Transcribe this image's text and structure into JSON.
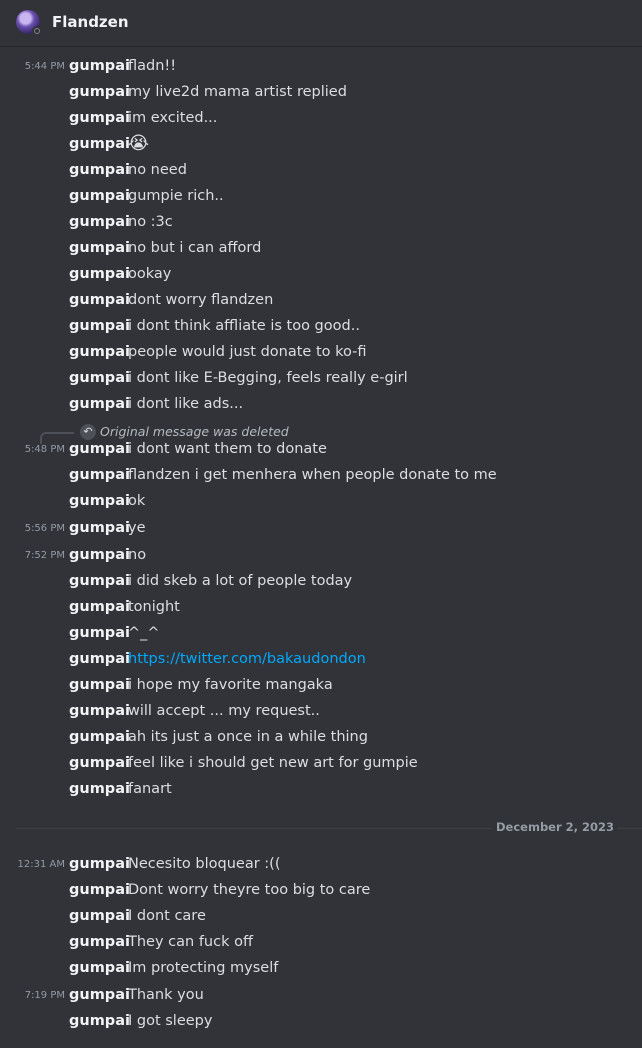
{
  "header": {
    "title": "Flandzen",
    "avatar_icon": "user-avatar-icon",
    "status_icon": "offline-status-icon"
  },
  "messages_before": [
    {
      "time": "5:44 PM",
      "author": "gumpai",
      "text": "fladn!!"
    },
    {
      "time": "",
      "author": "gumpai",
      "text": "my live2d mama artist replied"
    },
    {
      "time": "",
      "author": "gumpai",
      "text": "im excited..."
    },
    {
      "time": "",
      "author": "gumpai",
      "text": "😭"
    },
    {
      "time": "",
      "author": "gumpai",
      "text": "no need"
    },
    {
      "time": "",
      "author": "gumpai",
      "text": "gumpie rich.."
    },
    {
      "time": "",
      "author": "gumpai",
      "text": "no :3c"
    },
    {
      "time": "",
      "author": "gumpai",
      "text": "no but i can afford"
    },
    {
      "time": "",
      "author": "gumpai",
      "text": "ookay"
    },
    {
      "time": "",
      "author": "gumpai",
      "text": "dont worry flandzen"
    },
    {
      "time": "",
      "author": "gumpai",
      "text": "i dont think affliate is too good.."
    },
    {
      "time": "",
      "author": "gumpai",
      "text": "people would just donate to ko-fi"
    },
    {
      "time": "",
      "author": "gumpai",
      "text": "i dont like E-Begging, feels really e-girl"
    },
    {
      "time": "",
      "author": "gumpai",
      "text": "i dont like ads..."
    }
  ],
  "reply": {
    "icon": "reply-arrow-icon",
    "text": "Original message was deleted"
  },
  "messages_after": [
    {
      "time": "5:48 PM",
      "author": "gumpai",
      "text": "i dont want them to donate"
    },
    {
      "time": "",
      "author": "gumpai",
      "text": "flandzen i get menhera when people donate to me"
    },
    {
      "time": "",
      "author": "gumpai",
      "text": "ok"
    },
    {
      "time": "5:56 PM",
      "author": "gumpai",
      "text": "ye"
    },
    {
      "time": "7:52 PM",
      "author": "gumpai",
      "text": "no"
    },
    {
      "time": "",
      "author": "gumpai",
      "text": "i did skeb a lot of people today"
    },
    {
      "time": "",
      "author": "gumpai",
      "text": "tonight"
    },
    {
      "time": "",
      "author": "gumpai",
      "text": "^_^"
    },
    {
      "time": "",
      "author": "gumpai",
      "text": "https://twitter.com/bakaudondon",
      "link": true
    },
    {
      "time": "",
      "author": "gumpai",
      "text": "i hope my favorite mangaka"
    },
    {
      "time": "",
      "author": "gumpai",
      "text": "will accept ... my request.."
    },
    {
      "time": "",
      "author": "gumpai",
      "text": "ah its just a once in a while thing"
    },
    {
      "time": "",
      "author": "gumpai",
      "text": "feel like i should get new art for gumpie"
    },
    {
      "time": "",
      "author": "gumpai",
      "text": "fanart"
    }
  ],
  "date_divider": "December 2, 2023",
  "messages_dec2": [
    {
      "time": "12:31 AM",
      "author": "gumpai",
      "text": "Necesito bloquear :(("
    },
    {
      "time": "",
      "author": "gumpai",
      "text": "Dont worry theyre too big to care"
    },
    {
      "time": "",
      "author": "gumpai",
      "text": "I dont care"
    },
    {
      "time": "",
      "author": "gumpai",
      "text": "They can fuck off"
    },
    {
      "time": "",
      "author": "gumpai",
      "text": "Im protecting myself"
    },
    {
      "time": "7:19 PM",
      "author": "gumpai",
      "text": "Thank you"
    },
    {
      "time": "",
      "author": "gumpai",
      "text": "I got sleepy"
    }
  ],
  "colors": {
    "background": "#313338",
    "text": "#dbdee1",
    "author": "#f2f3f5",
    "timestamp": "#949ba4",
    "link": "#00a8fc"
  }
}
